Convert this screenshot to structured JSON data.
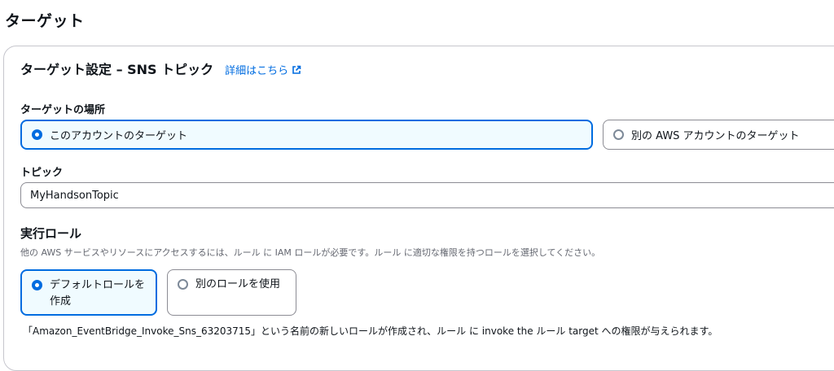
{
  "page": {
    "title": "ターゲット"
  },
  "card": {
    "title": "ターゲット設定 – SNS トピック",
    "info_link": "詳細はこちら"
  },
  "target_location": {
    "label": "ターゲットの場所",
    "options": [
      {
        "label": "このアカウントのターゲット",
        "selected": true
      },
      {
        "label": "別の AWS アカウントのターゲット",
        "selected": false
      }
    ]
  },
  "topic": {
    "label": "トピック",
    "value": "MyHandsonTopic"
  },
  "execution_role": {
    "label": "実行ロール",
    "description": "他の AWS サービスやリソースにアクセスするには、ルール に IAM ロールが必要です。ルール に適切な権限を持つロールを選択してください。",
    "options": [
      {
        "label": "デフォルトロールを作成",
        "selected": true
      },
      {
        "label": "別のロールを使用",
        "selected": false
      }
    ],
    "note": "「Amazon_EventBridge_Invoke_Sns_63203715」という名前の新しいロールが作成され、ルール に invoke the ルール target への権限が与えられます。"
  },
  "colors": {
    "accent": "#006ce0",
    "selected_bg": "#f0fbff",
    "border": "#8c8c94",
    "muted_text": "#656871"
  },
  "icons": {
    "info_link": "external-link-icon"
  }
}
